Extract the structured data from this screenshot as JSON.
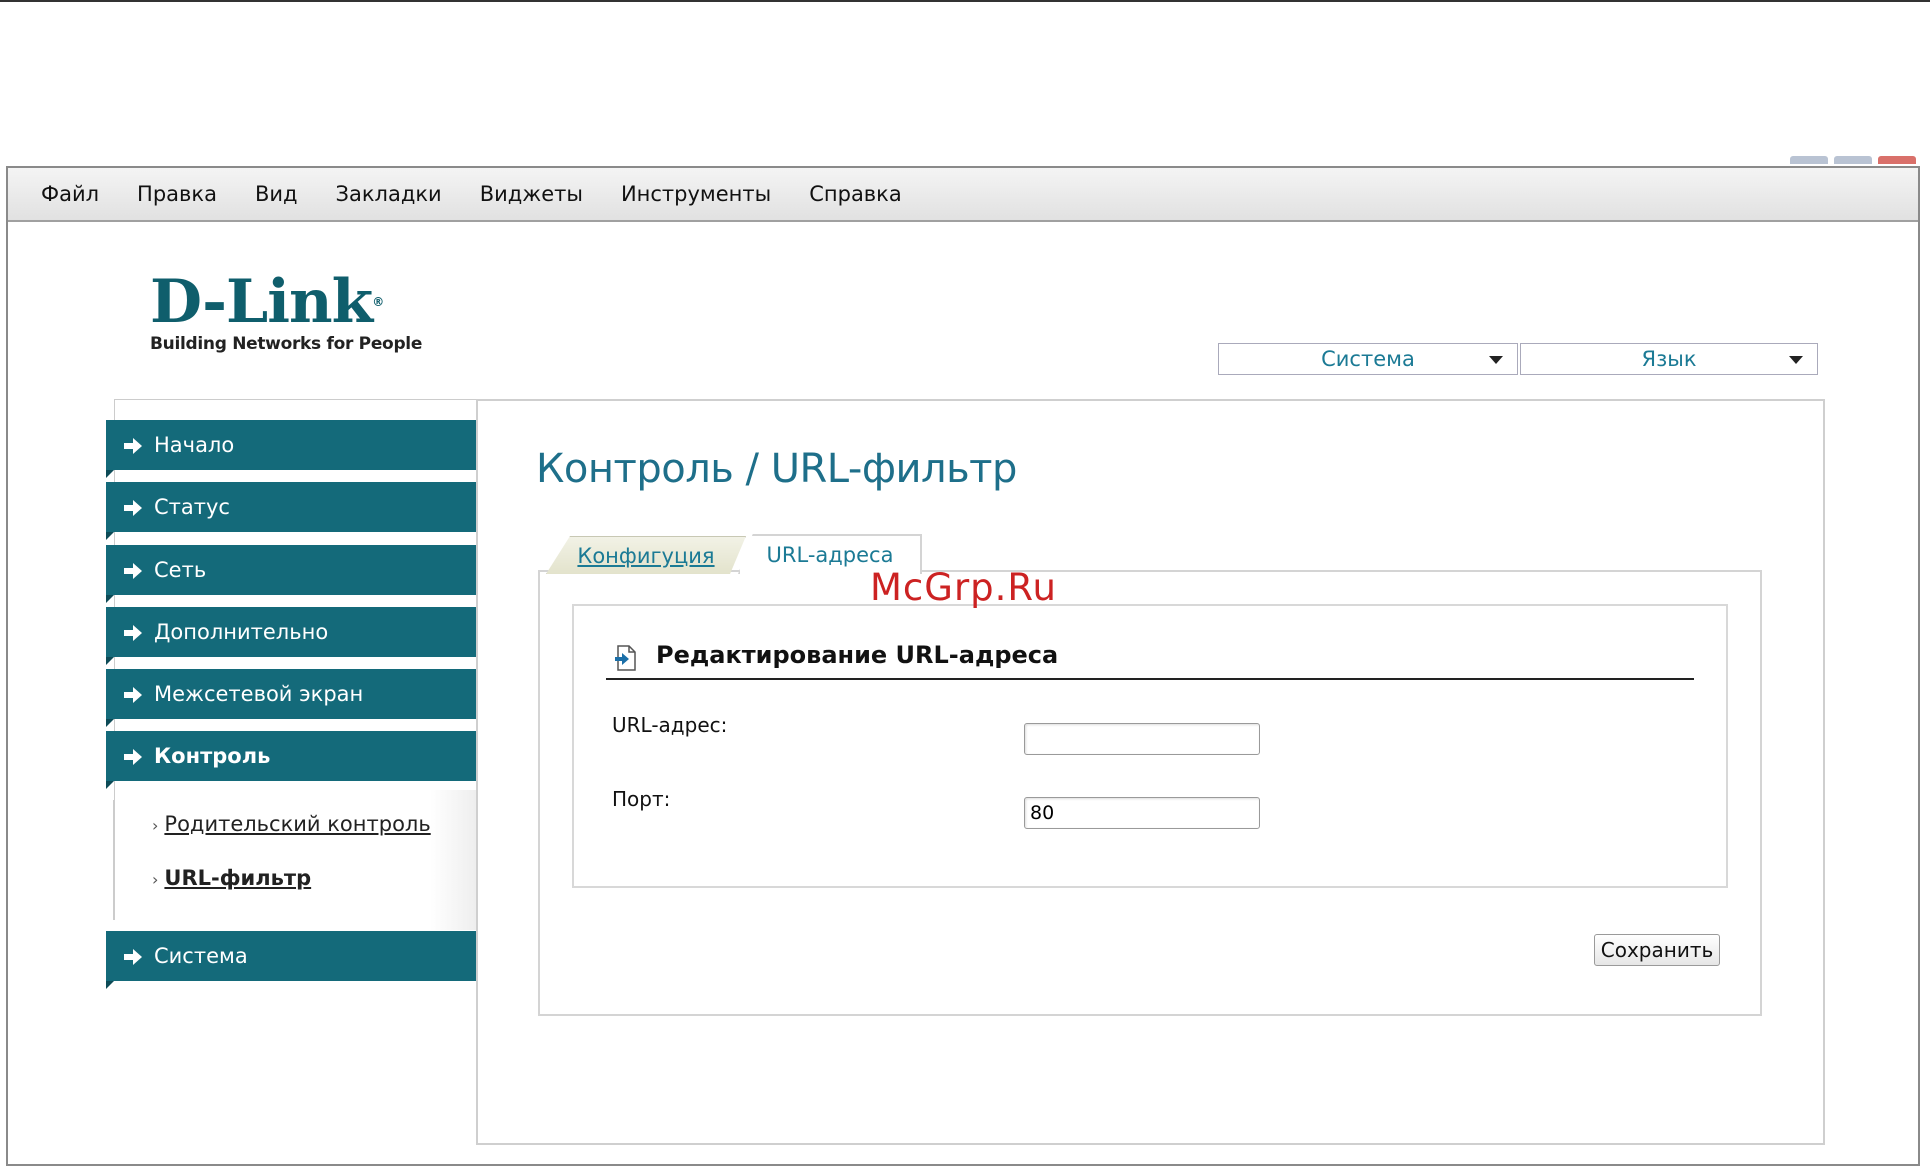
{
  "browser": {
    "menu": [
      "Файл",
      "Правка",
      "Вид",
      "Закладки",
      "Виджеты",
      "Инструменты",
      "Справка"
    ]
  },
  "brand": {
    "logo_text": "D-Link",
    "tagline": "Building Networks for People"
  },
  "header": {
    "system_select": "Система",
    "language_select": "Язык"
  },
  "sidebar": {
    "items": [
      {
        "label": "Начало"
      },
      {
        "label": "Статус"
      },
      {
        "label": "Сеть"
      },
      {
        "label": "Дополнительно"
      },
      {
        "label": "Межсетевой экран"
      },
      {
        "label": "Контроль"
      },
      {
        "label": "Система"
      }
    ],
    "subitems": [
      {
        "label": "Родительский контроль"
      },
      {
        "label": "URL-фильтр"
      }
    ]
  },
  "main": {
    "title": "Контроль /  URL-фильтр",
    "tabs": [
      {
        "label": "Конфигуция"
      },
      {
        "label": "URL-адреса"
      }
    ],
    "watermark": "McGrp.Ru",
    "section_title": "Редактирование URL-адреса",
    "fields": {
      "url_label": "URL-адрес:",
      "url_value": "",
      "port_label": "Порт:",
      "port_value": "80"
    },
    "save_label": "Сохранить"
  }
}
